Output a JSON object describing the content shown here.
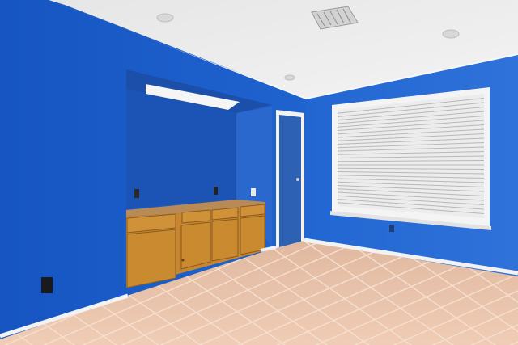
{
  "scene": {
    "description_tags": [
      "empty-room",
      "blue-walls",
      "tile-floor",
      "window-blinds",
      "built-in-cabinet",
      "blue-door"
    ],
    "colors": {
      "wall_left": "#1a5cc8",
      "wall_right": "#2a6fd6",
      "ceiling": "#ececec",
      "floor": "#e8c2a8",
      "grout": "#f4dccb",
      "cabinet": "#c7862f",
      "counter": "#b88a55",
      "door": "#2d61b4",
      "baseboard": "#f2f2f2",
      "window_frame": "#f4f4f4",
      "blinds": "#ededed"
    }
  }
}
